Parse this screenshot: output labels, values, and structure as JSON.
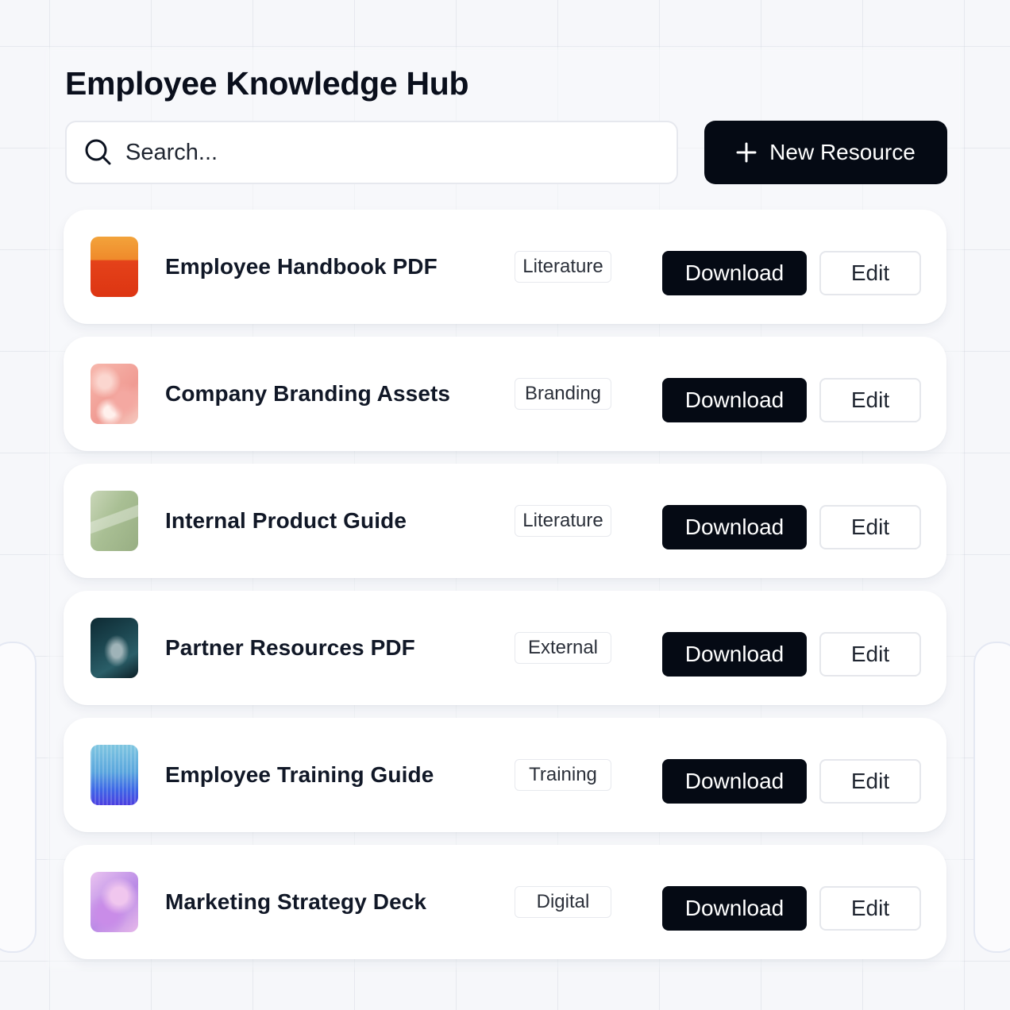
{
  "page": {
    "title": "Employee Knowledge Hub"
  },
  "search": {
    "placeholder": "Search...",
    "icon": "search-icon"
  },
  "new_resource": {
    "label": "New Resource",
    "icon": "plus-icon"
  },
  "colors": {
    "primary_button": "#050a14",
    "text": "#111827",
    "background": "#f6f7fa"
  },
  "resources": [
    {
      "title": "Employee Handbook PDF",
      "tag": "Literature",
      "download": "Download",
      "edit": "Edit"
    },
    {
      "title": "Company Branding Assets",
      "tag": "Branding",
      "download": "Download",
      "edit": "Edit"
    },
    {
      "title": "Internal Product Guide",
      "tag": "Literature",
      "download": "Download",
      "edit": "Edit"
    },
    {
      "title": "Partner Resources PDF",
      "tag": "External",
      "download": "Download",
      "edit": "Edit"
    },
    {
      "title": "Employee Training Guide",
      "tag": "Training",
      "download": "Download",
      "edit": "Edit"
    },
    {
      "title": "Marketing Strategy Deck",
      "tag": "Digital",
      "download": "Download",
      "edit": "Edit"
    }
  ]
}
